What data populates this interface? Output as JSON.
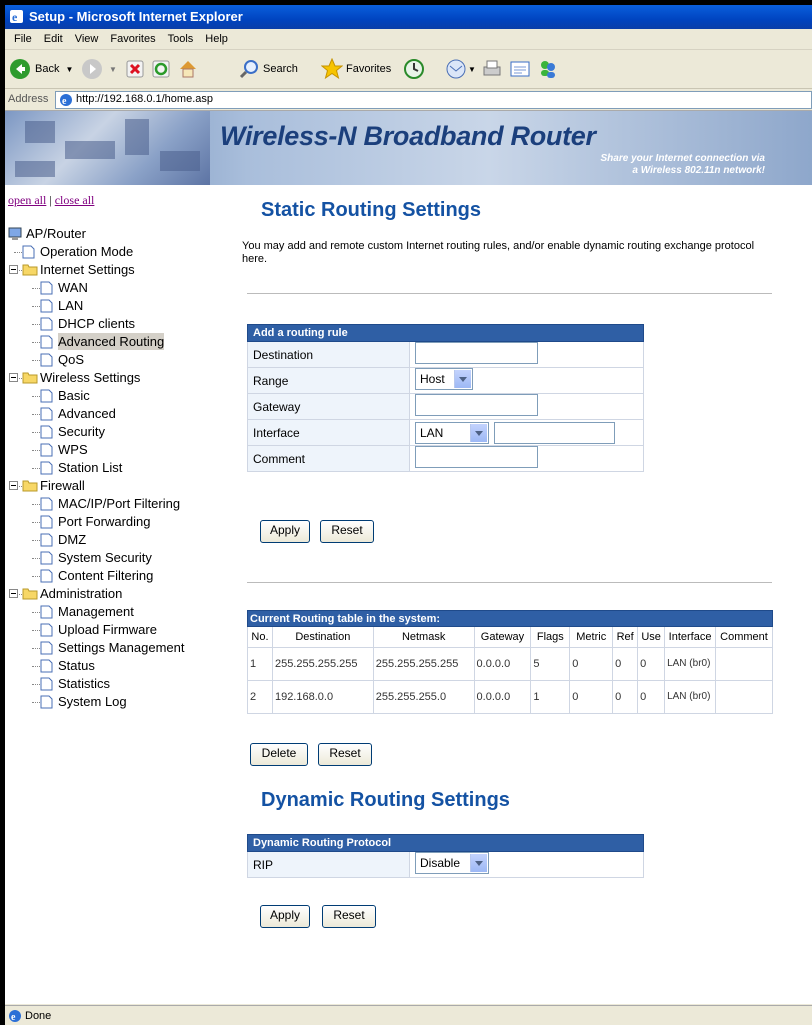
{
  "window": {
    "title": "Setup - Microsoft Internet Explorer"
  },
  "menu": [
    "File",
    "Edit",
    "View",
    "Favorites",
    "Tools",
    "Help"
  ],
  "toolbar": {
    "back": "Back",
    "search": "Search",
    "favorites": "Favorites"
  },
  "address": {
    "label": "Address",
    "url": "http://192.168.0.1/home.asp"
  },
  "banner": {
    "title": "Wireless-N Broadband Router",
    "subtitle_line1": "Share your Internet connection via",
    "subtitle_line2": "a Wireless 802.11n network!"
  },
  "sidebar": {
    "open_all": "open all",
    "separator": "|",
    "close_all": "close all",
    "tree": [
      {
        "label": "AP/Router",
        "level": 0,
        "kind": "root"
      },
      {
        "label": "Operation Mode",
        "level": 1,
        "kind": "page"
      },
      {
        "label": "Internet Settings",
        "level": 1,
        "kind": "folder"
      },
      {
        "label": "WAN",
        "level": 2,
        "kind": "page"
      },
      {
        "label": "LAN",
        "level": 2,
        "kind": "page"
      },
      {
        "label": "DHCP clients",
        "level": 2,
        "kind": "page"
      },
      {
        "label": "Advanced Routing",
        "level": 2,
        "kind": "page",
        "selected": true
      },
      {
        "label": "QoS",
        "level": 2,
        "kind": "page"
      },
      {
        "label": "Wireless Settings",
        "level": 1,
        "kind": "folder"
      },
      {
        "label": "Basic",
        "level": 2,
        "kind": "page"
      },
      {
        "label": "Advanced",
        "level": 2,
        "kind": "page"
      },
      {
        "label": "Security",
        "level": 2,
        "kind": "page"
      },
      {
        "label": "WPS",
        "level": 2,
        "kind": "page"
      },
      {
        "label": "Station List",
        "level": 2,
        "kind": "page"
      },
      {
        "label": "Firewall",
        "level": 1,
        "kind": "folder"
      },
      {
        "label": "MAC/IP/Port Filtering",
        "level": 2,
        "kind": "page"
      },
      {
        "label": "Port Forwarding",
        "level": 2,
        "kind": "page"
      },
      {
        "label": "DMZ",
        "level": 2,
        "kind": "page"
      },
      {
        "label": "System Security",
        "level": 2,
        "kind": "page"
      },
      {
        "label": "Content Filtering",
        "level": 2,
        "kind": "page"
      },
      {
        "label": "Administration",
        "level": 1,
        "kind": "folder"
      },
      {
        "label": "Management",
        "level": 2,
        "kind": "page"
      },
      {
        "label": "Upload Firmware",
        "level": 2,
        "kind": "page"
      },
      {
        "label": "Settings Management",
        "level": 2,
        "kind": "page"
      },
      {
        "label": "Status",
        "level": 2,
        "kind": "page"
      },
      {
        "label": "Statistics",
        "level": 2,
        "kind": "page"
      },
      {
        "label": "System Log",
        "level": 2,
        "kind": "page"
      }
    ]
  },
  "static": {
    "title": "Static Routing Settings",
    "description": "You may add and remote custom Internet routing rules, and/or enable dynamic routing exchange protocol here.",
    "add_rule_header": "Add a routing rule",
    "fields": {
      "destination": "Destination",
      "range": "Range",
      "range_value": "Host",
      "gateway": "Gateway",
      "interface": "Interface",
      "interface_value": "LAN",
      "comment": "Comment"
    },
    "apply": "Apply",
    "reset": "Reset"
  },
  "routing_table": {
    "header": "Current Routing table in the system:",
    "columns": [
      "No.",
      "Destination",
      "Netmask",
      "Gateway",
      "Flags",
      "Metric",
      "Ref",
      "Use",
      "Interface",
      "Comment"
    ],
    "rows": [
      [
        "1",
        "255.255.255.255",
        "255.255.255.255",
        "0.0.0.0",
        "5",
        "0",
        "0",
        "0",
        "LAN (br0)",
        ""
      ],
      [
        "2",
        "192.168.0.0",
        "255.255.255.0",
        "0.0.0.0",
        "1",
        "0",
        "0",
        "0",
        "LAN (br0)",
        ""
      ]
    ],
    "delete": "Delete",
    "reset": "Reset"
  },
  "dynamic": {
    "title": "Dynamic Routing Settings",
    "header": "Dynamic Routing Protocol",
    "rip_label": "RIP",
    "rip_value": "Disable",
    "apply": "Apply",
    "reset": "Reset"
  },
  "statusbar": {
    "text": "Done"
  }
}
